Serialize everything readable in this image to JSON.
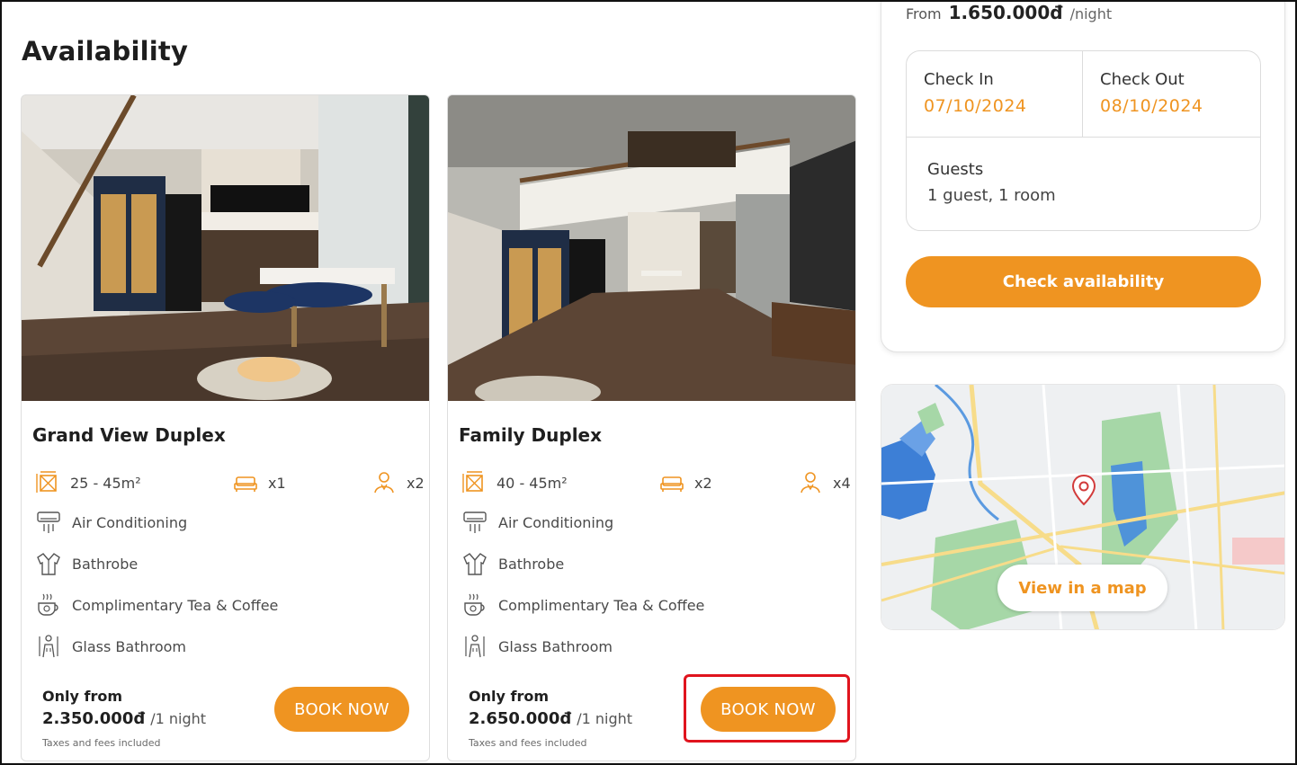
{
  "page": {
    "section_title": "Availability"
  },
  "rooms": [
    {
      "name": "Grand View Duplex",
      "area": "25 - 45m²",
      "beds": "x1",
      "guests": "x2",
      "amenities": [
        "Air Conditioning",
        "Bathrobe",
        "Complimentary Tea & Coffee",
        "Glass Bathroom"
      ],
      "only_from_label": "Only from",
      "price": "2.350.000đ",
      "per_night": "/1 night",
      "taxes_note": "Taxes and fees included",
      "book_label": "BOOK NOW"
    },
    {
      "name": "Family Duplex",
      "area": "40 - 45m²",
      "beds": "x2",
      "guests": "x4",
      "amenities": [
        "Air Conditioning",
        "Bathrobe",
        "Complimentary Tea & Coffee",
        "Glass Bathroom"
      ],
      "only_from_label": "Only from",
      "price": "2.650.000đ",
      "per_night": "/1 night",
      "taxes_note": "Taxes and fees included",
      "book_label": "BOOK NOW"
    }
  ],
  "booking": {
    "from_label": "From",
    "from_price": "1.650.000đ",
    "from_per": "/night",
    "check_in_label": "Check In",
    "check_in_value": "07/10/2024",
    "check_out_label": "Check Out",
    "check_out_value": "08/10/2024",
    "guests_label": "Guests",
    "guests_value": "1 guest, 1 room",
    "check_button": "Check availability"
  },
  "map": {
    "button_label": "View in a map"
  },
  "colors": {
    "accent": "#ef9421",
    "highlight": "#e0141e"
  },
  "icons": {
    "area": "area-icon",
    "bed": "bed-icon",
    "guest": "guest-icon",
    "air_conditioning": "air-conditioner-icon",
    "bathrobe": "bathrobe-icon",
    "tea_coffee": "tea-cup-icon",
    "glass_bathroom": "shower-icon",
    "map_pin": "map-pin-icon"
  }
}
